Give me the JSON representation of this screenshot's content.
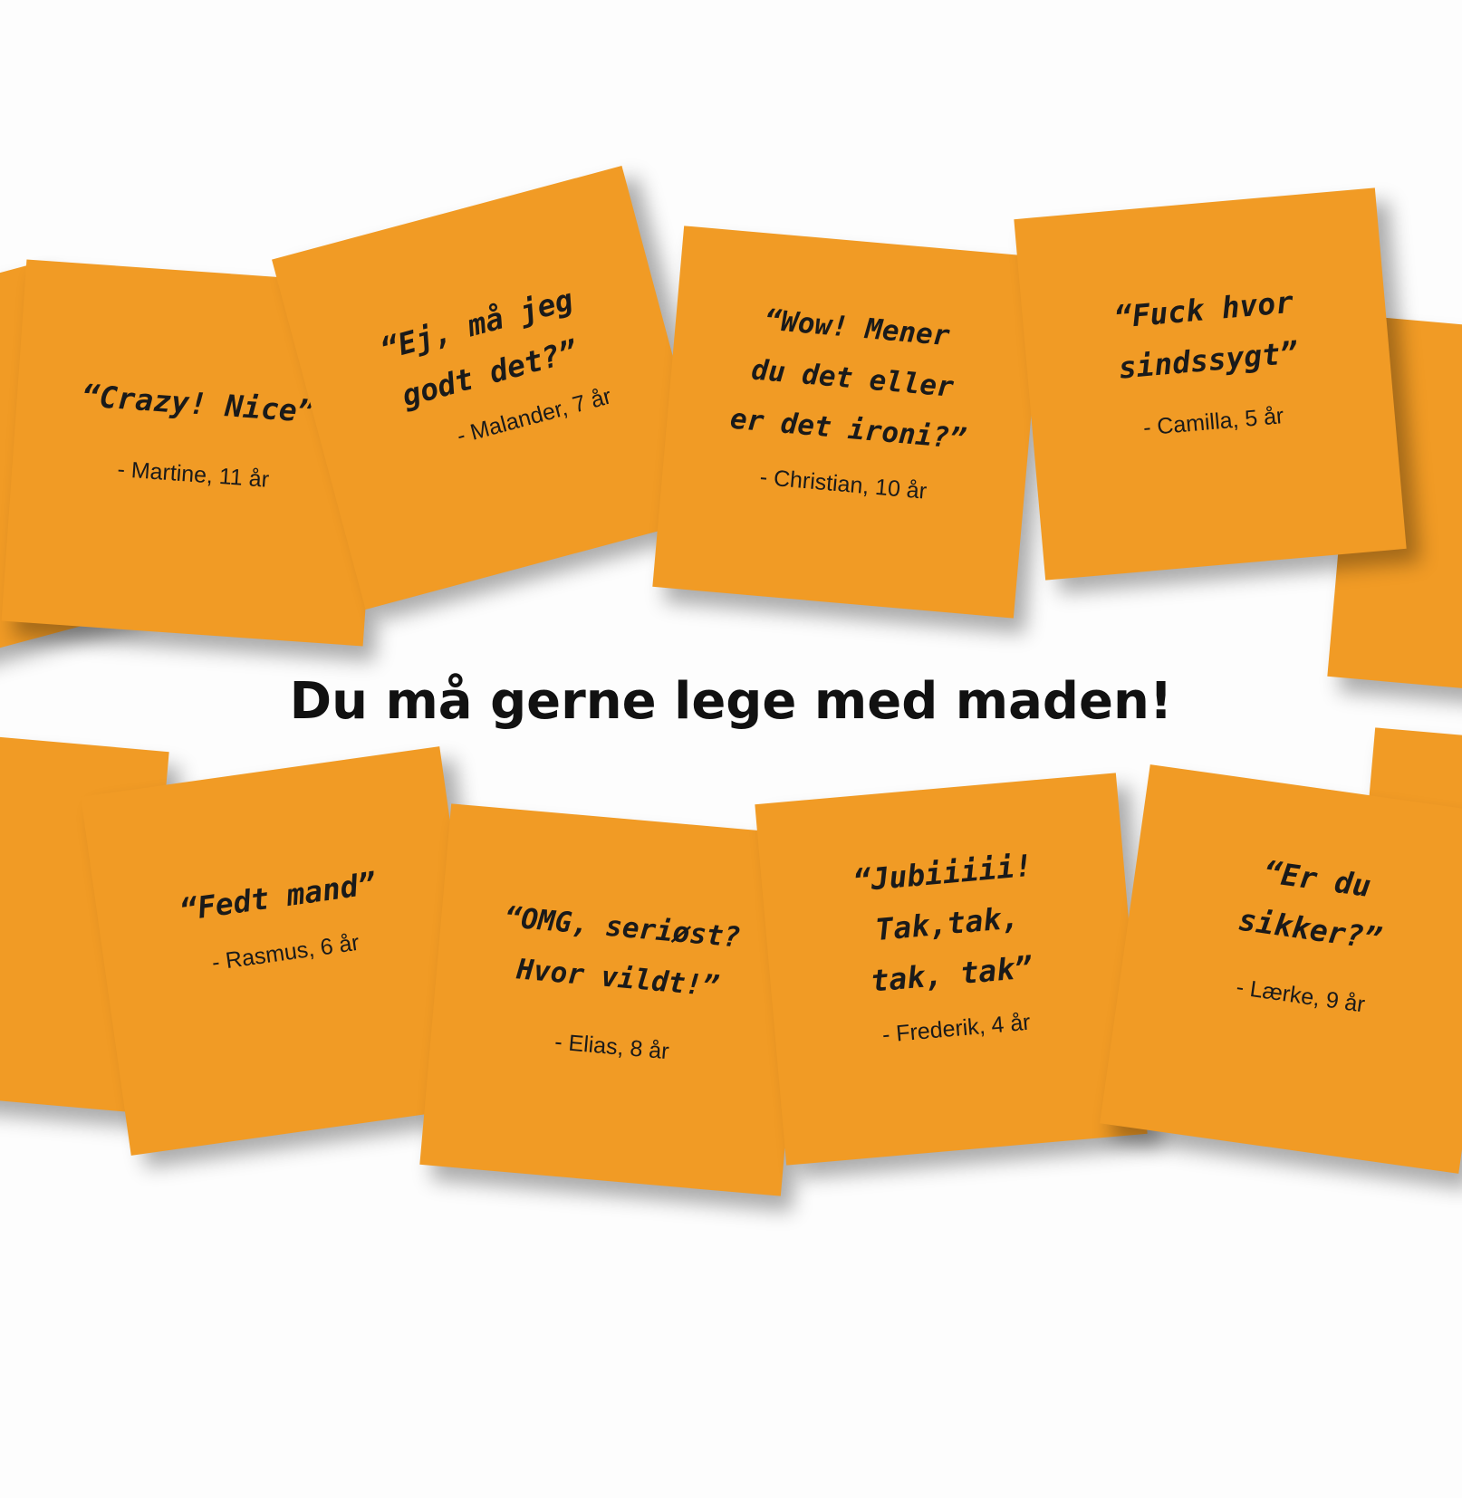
{
  "headline": "Du må gerne lege med maden!",
  "notes": [
    {
      "quote": "“Crazy! Nice”",
      "author": "- Martine, 11 år"
    },
    {
      "quote": "“Ej, må jeg\ngodt det?”",
      "author": "- Malander, 7 år"
    },
    {
      "quote": "“Wow! Mener\ndu det eller\ner det ironi?”",
      "author": "- Christian, 10 år"
    },
    {
      "quote": "“Fuck hvor\nsindssygt”",
      "author": "- Camilla, 5 år"
    },
    {
      "quote": "“Fedt mand”",
      "author": "- Rasmus, 6 år"
    },
    {
      "quote": "“OMG, seriøst?\nHvor vildt!”",
      "author": "- Elias, 8 år"
    },
    {
      "quote": "“Jubiiiii!\nTak,tak,\ntak, tak”",
      "author": "- Frederik, 4 år"
    },
    {
      "quote": "“Er du\nsikker?”",
      "author": "- Lærke, 9 år"
    }
  ]
}
